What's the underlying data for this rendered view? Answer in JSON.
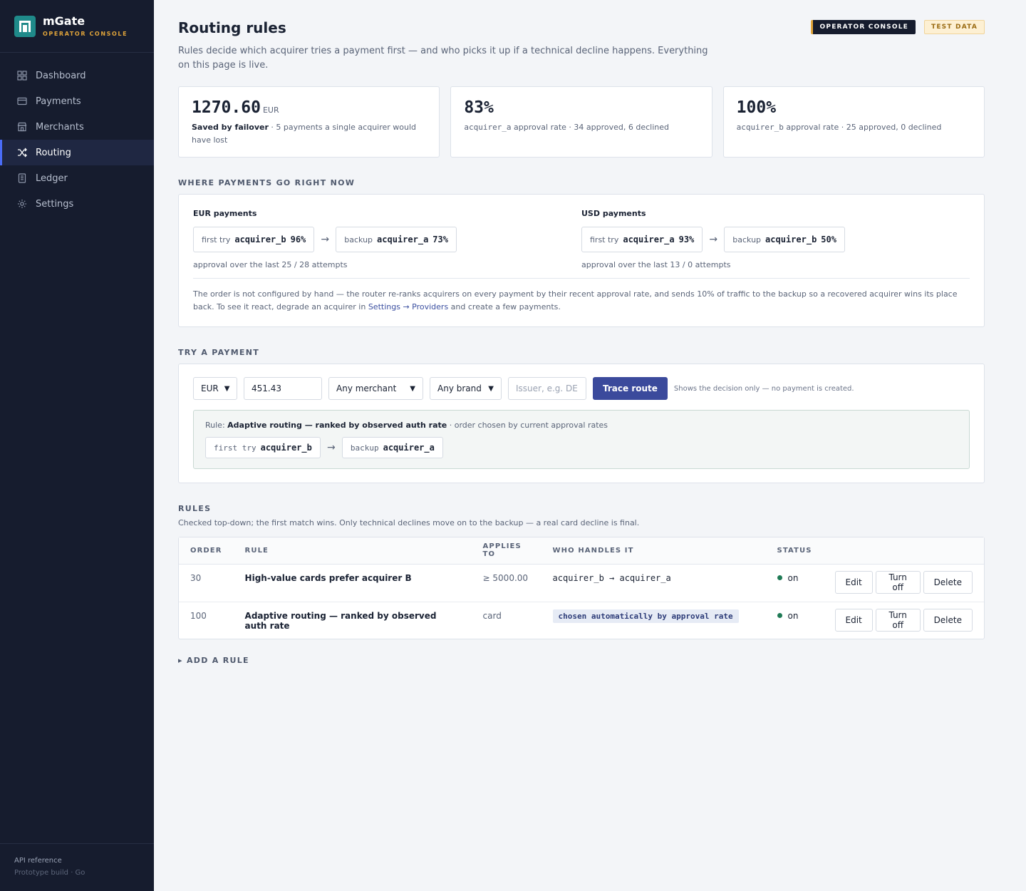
{
  "app": {
    "name": "mGate",
    "subtitle": "OPERATOR CONSOLE"
  },
  "sidebar": {
    "items": [
      {
        "label": "Dashboard",
        "icon": "grid-icon",
        "active": false
      },
      {
        "label": "Payments",
        "icon": "card-icon",
        "active": false
      },
      {
        "label": "Merchants",
        "icon": "store-icon",
        "active": false
      },
      {
        "label": "Routing",
        "icon": "shuffle-icon",
        "active": true
      },
      {
        "label": "Ledger",
        "icon": "book-icon",
        "active": false
      },
      {
        "label": "Settings",
        "icon": "gear-icon",
        "active": false
      }
    ],
    "footer": {
      "api": "API reference",
      "build": "Prototype build · Go"
    }
  },
  "header": {
    "title": "Routing rules",
    "badge_console": "OPERATOR CONSOLE",
    "badge_test": "TEST DATA",
    "intro": "Rules decide which acquirer tries a payment first — and who picks it up if a technical decline happens. Everything on this page is live."
  },
  "stats": [
    {
      "value": "1270.60",
      "unit": "EUR",
      "strong": "Saved by failover",
      "desc": " · 5 payments a single acquirer would have lost"
    },
    {
      "value": "83%",
      "mono_label": "acquirer_a",
      "desc": " approval rate · 34 approved, 6 declined"
    },
    {
      "value": "100%",
      "mono_label": "acquirer_b",
      "desc": " approval rate · 25 approved, 0 declined"
    }
  ],
  "routing_now": {
    "label": "WHERE PAYMENTS GO RIGHT NOW",
    "eur": {
      "title": "EUR payments",
      "first_label": "first try",
      "first_acq": "acquirer_b",
      "first_pct": "96%",
      "backup_label": "backup",
      "backup_acq": "acquirer_a",
      "backup_pct": "73%",
      "note": "approval over the last 25 / 28 attempts"
    },
    "usd": {
      "title": "USD payments",
      "first_label": "first try",
      "first_acq": "acquirer_a",
      "first_pct": "93%",
      "backup_label": "backup",
      "backup_acq": "acquirer_b",
      "backup_pct": "50%",
      "note": "approval over the last 13 / 0 attempts"
    },
    "explain_1": "The order is not configured by hand — the router re-ranks acquirers on every payment by their recent approval rate, and sends 10% of traffic to the backup so a recovered acquirer wins its place back. To see it react, degrade an acquirer in ",
    "explain_link": "Settings → Providers",
    "explain_2": " and create a few payments."
  },
  "try_payment": {
    "label": "TRY A PAYMENT",
    "currency": "EUR",
    "amount": "451.43",
    "merchant": "Any merchant",
    "brand": "Any brand",
    "issuer_placeholder": "Issuer, e.g. DE",
    "button": "Trace route",
    "hint": "Shows the decision only — no payment is created.",
    "result": {
      "prefix": "Rule: ",
      "rule": "Adaptive routing — ranked by observed auth rate",
      "suffix": " · order chosen by current approval rates",
      "first_label": "first try",
      "first_acq": "acquirer_b",
      "backup_label": "backup",
      "backup_acq": "acquirer_a"
    }
  },
  "rules": {
    "label": "RULES",
    "sub": "Checked top-down; the first match wins. Only technical declines move on to the backup — a real card decline is final.",
    "columns": [
      "ORDER",
      "RULE",
      "APPLIES TO",
      "WHO HANDLES IT",
      "STATUS",
      ""
    ],
    "rows": [
      {
        "order": "30",
        "rule": "High-value cards prefer acquirer B",
        "applies": "≥ 5000.00",
        "handlers": "acquirer_b → acquirer_a",
        "status": "on",
        "edit": "Edit",
        "toggle": "Turn off",
        "delete": "Delete"
      },
      {
        "order": "100",
        "rule": "Adaptive routing — ranked by observed auth rate",
        "applies": "card",
        "handlers": "chosen automatically by approval rate",
        "status": "on",
        "edit": "Edit",
        "toggle": "Turn off",
        "delete": "Delete"
      }
    ],
    "add_rule": "▸ ADD A RULE"
  }
}
